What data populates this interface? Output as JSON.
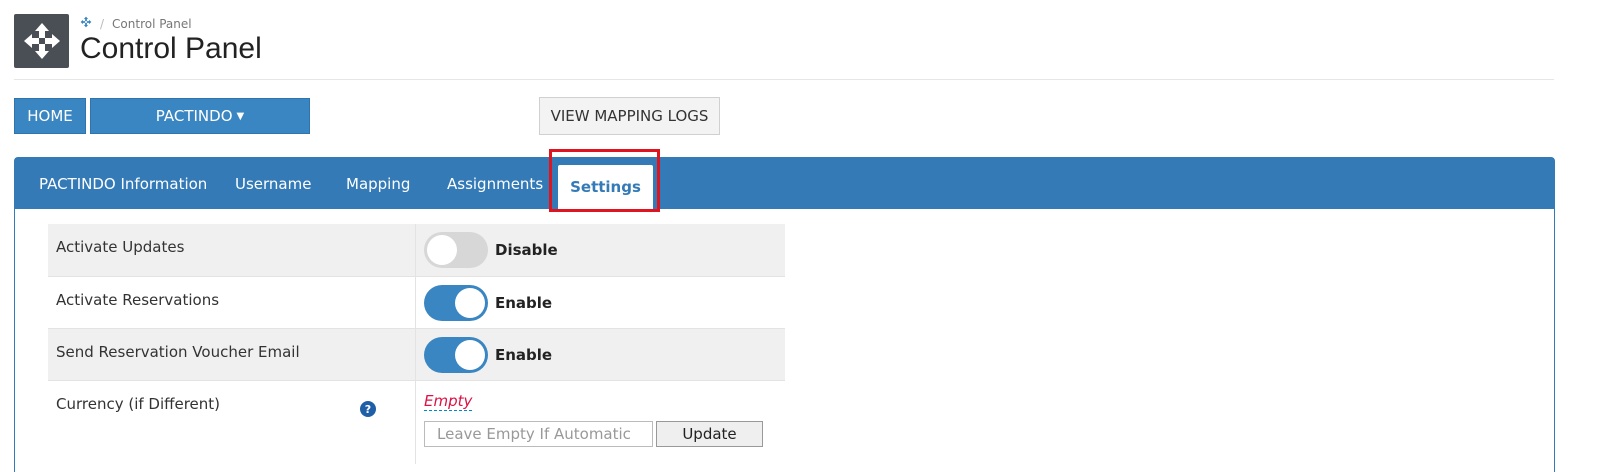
{
  "header": {
    "breadcrumb": "Control Panel",
    "title": "Control Panel",
    "logo_icon": "move-arrows-icon",
    "breadcrumb_icon": "move-arrows-icon"
  },
  "toolbar": {
    "home_label": "HOME",
    "pactindo_label": "PACTINDO",
    "logs_label": "VIEW MAPPING LOGS"
  },
  "tabs": [
    {
      "label": "PACTINDO Information"
    },
    {
      "label": "Username"
    },
    {
      "label": "Mapping"
    },
    {
      "label": "Assignments"
    },
    {
      "label": "Settings",
      "active": true
    }
  ],
  "settings": {
    "rows": [
      {
        "label": "Activate Updates",
        "state": "off",
        "state_label": "Disable"
      },
      {
        "label": "Activate Reservations",
        "state": "on",
        "state_label": "Enable"
      },
      {
        "label": "Send Reservation Voucher Email",
        "state": "on",
        "state_label": "Enable"
      },
      {
        "label": "Currency (if Different)",
        "value": "Empty",
        "placeholder": "Leave Empty If Automatic",
        "button": "Update"
      }
    ]
  },
  "colors": {
    "primary": "#337ab7",
    "highlight": "#e0141e",
    "empty_text": "#dd1144"
  }
}
